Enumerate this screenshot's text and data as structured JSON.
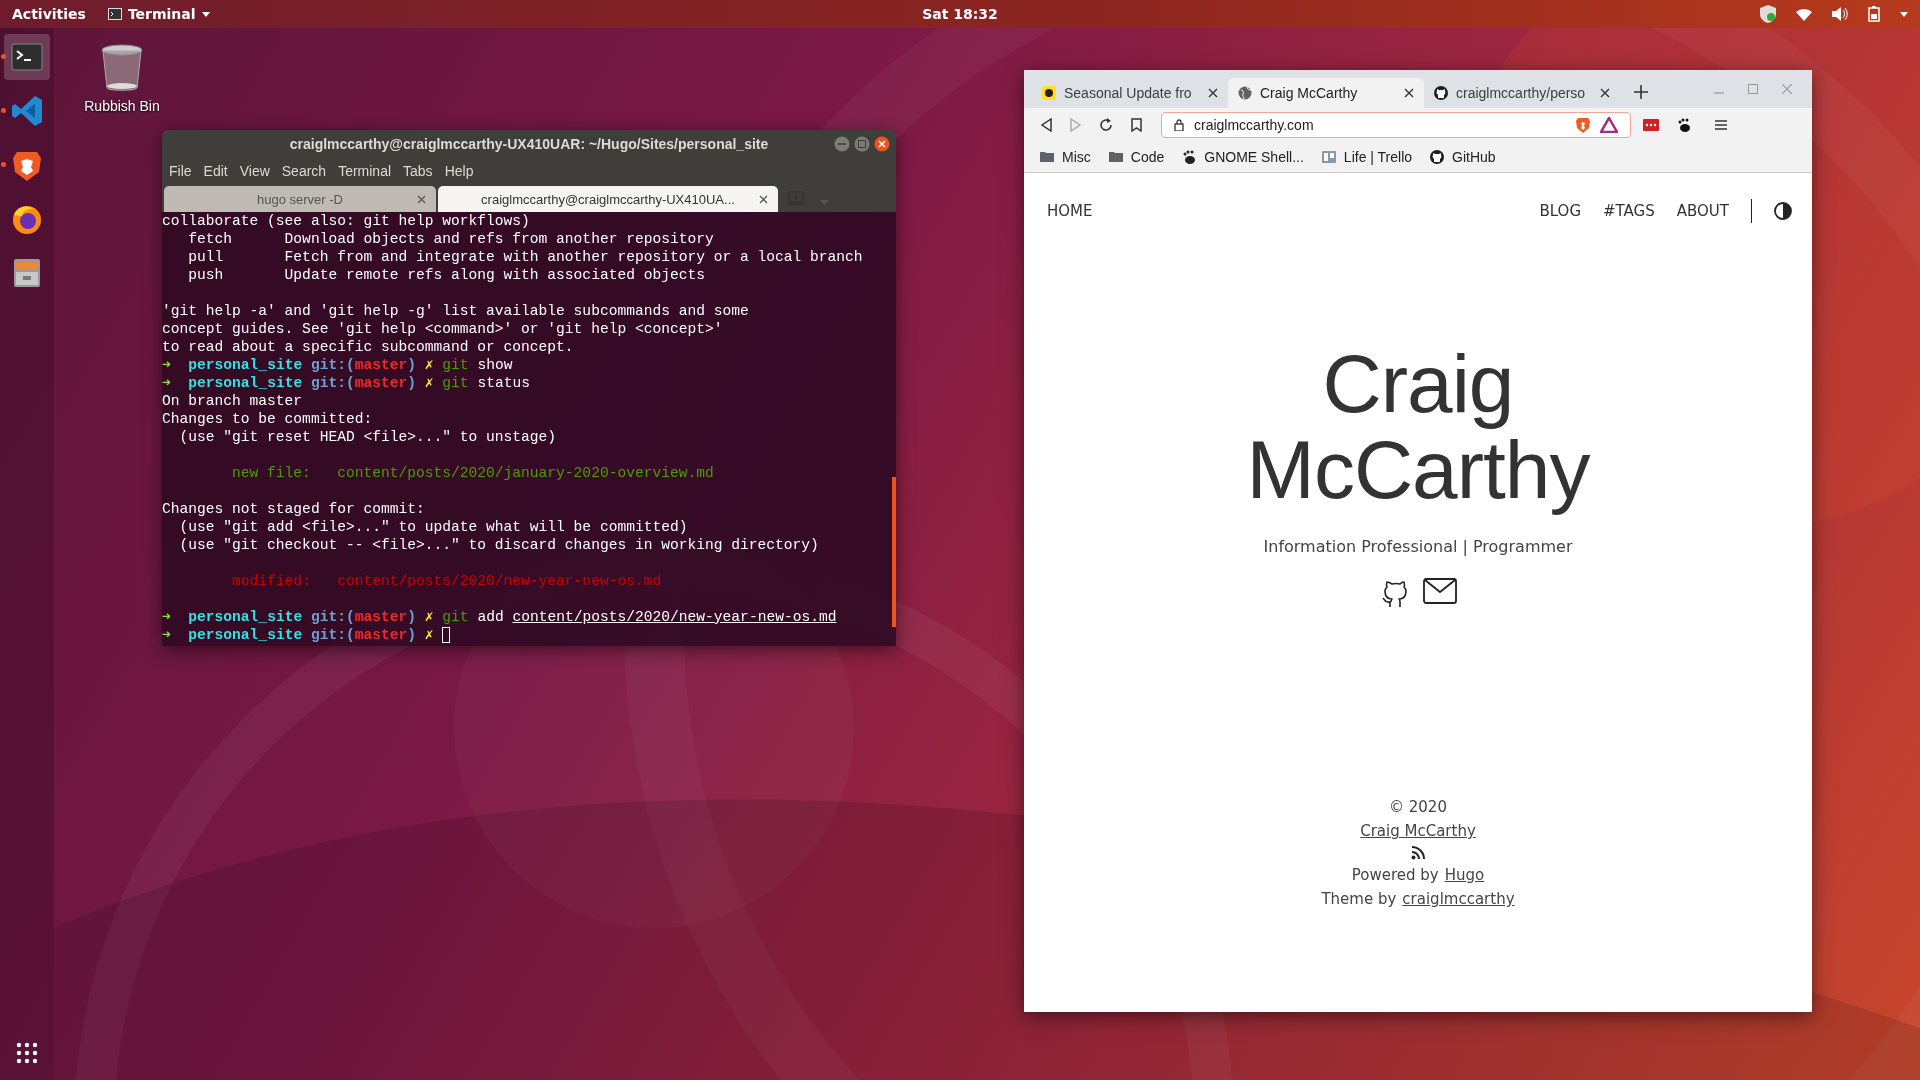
{
  "top_bar": {
    "activities": "Activities",
    "app_menu": "Terminal",
    "clock": "Sat 18:32"
  },
  "dock": {
    "items": [
      {
        "kind": "terminal",
        "running": true,
        "selected": true
      },
      {
        "kind": "code-editor",
        "running": true,
        "selected": false
      },
      {
        "kind": "lion-browser",
        "running": true,
        "selected": false
      },
      {
        "kind": "fox-browser",
        "running": false,
        "selected": false
      },
      {
        "kind": "files",
        "running": false,
        "selected": false
      }
    ]
  },
  "desktop_icons": [
    {
      "label": "Rubbish Bin"
    }
  ],
  "terminal": {
    "title": "craiglmccarthy@craiglmccarthy-UX410UAR: ~/Hugo/Sites/personal_site",
    "menu": [
      "File",
      "Edit",
      "View",
      "Search",
      "Terminal",
      "Tabs",
      "Help"
    ],
    "tabs": [
      {
        "label": "hugo server -D",
        "selected": false
      },
      {
        "label": "craiglmccarthy@craiglmccarthy-UX410UA...",
        "selected": true
      }
    ],
    "lines": [
      {
        "kind": "text",
        "segments": [
          {
            "kind": "plain",
            "text": "collaborate (see also: git help workflows)"
          }
        ]
      },
      {
        "kind": "text",
        "segments": [
          {
            "kind": "plain",
            "text": "   fetch      Download objects and refs from another repository"
          }
        ]
      },
      {
        "kind": "text",
        "segments": [
          {
            "kind": "plain",
            "text": "   pull       Fetch from and integrate with another repository or a local branch"
          }
        ]
      },
      {
        "kind": "text",
        "segments": [
          {
            "kind": "plain",
            "text": "   push       Update remote refs along with associated objects"
          }
        ]
      },
      {
        "kind": "blank"
      },
      {
        "kind": "text",
        "segments": [
          {
            "kind": "plain",
            "text": "'git help -a' and 'git help -g' list available subcommands and some"
          }
        ]
      },
      {
        "kind": "text",
        "segments": [
          {
            "kind": "plain",
            "text": "concept guides. See 'git help <command>' or 'git help <concept>'"
          }
        ]
      },
      {
        "kind": "text",
        "segments": [
          {
            "kind": "plain",
            "text": "to read about a specific subcommand or concept."
          }
        ]
      },
      {
        "kind": "text",
        "segments": [
          {
            "kind": "arrow",
            "text": "➜  "
          },
          {
            "kind": "dir",
            "text": "personal_site"
          },
          {
            "kind": "git",
            "text": " git:("
          },
          {
            "kind": "branch",
            "text": "master"
          },
          {
            "kind": "git",
            "text": ")"
          },
          {
            "kind": "dirty",
            "text": " ✗ "
          },
          {
            "kind": "cmd",
            "text": "git"
          },
          {
            "kind": "plain",
            "text": " show"
          }
        ]
      },
      {
        "kind": "text",
        "segments": [
          {
            "kind": "arrow",
            "text": "➜  "
          },
          {
            "kind": "dir",
            "text": "personal_site"
          },
          {
            "kind": "git",
            "text": " git:("
          },
          {
            "kind": "branch",
            "text": "master"
          },
          {
            "kind": "git",
            "text": ")"
          },
          {
            "kind": "dirty",
            "text": " ✗ "
          },
          {
            "kind": "cmd",
            "text": "git"
          },
          {
            "kind": "plain",
            "text": " status"
          }
        ]
      },
      {
        "kind": "text",
        "segments": [
          {
            "kind": "plain",
            "text": "On branch master"
          }
        ]
      },
      {
        "kind": "text",
        "segments": [
          {
            "kind": "plain",
            "text": "Changes to be committed:"
          }
        ]
      },
      {
        "kind": "text",
        "segments": [
          {
            "kind": "plain",
            "text": "  (use \"git reset HEAD <file>...\" to unstage)"
          }
        ]
      },
      {
        "kind": "blank"
      },
      {
        "kind": "text",
        "segments": [
          {
            "kind": "staged",
            "text": "        new file:   content/posts/2020/january-2020-overview.md"
          }
        ]
      },
      {
        "kind": "blank"
      },
      {
        "kind": "text",
        "segments": [
          {
            "kind": "plain",
            "text": "Changes not staged for commit:"
          }
        ]
      },
      {
        "kind": "text",
        "segments": [
          {
            "kind": "plain",
            "text": "  (use \"git add <file>...\" to update what will be committed)"
          }
        ]
      },
      {
        "kind": "text",
        "segments": [
          {
            "kind": "plain",
            "text": "  (use \"git checkout -- <file>...\" to discard changes in working directory)"
          }
        ]
      },
      {
        "kind": "blank"
      },
      {
        "kind": "text",
        "segments": [
          {
            "kind": "unstaged",
            "text": "        modified:   content/posts/2020/new-year-new-os.md"
          }
        ]
      },
      {
        "kind": "blank"
      },
      {
        "kind": "text",
        "segments": [
          {
            "kind": "arrow",
            "text": "➜  "
          },
          {
            "kind": "dir",
            "text": "personal_site"
          },
          {
            "kind": "git",
            "text": " git:("
          },
          {
            "kind": "branch",
            "text": "master"
          },
          {
            "kind": "git",
            "text": ")"
          },
          {
            "kind": "dirty",
            "text": " ✗ "
          },
          {
            "kind": "cmd",
            "text": "git"
          },
          {
            "kind": "plain",
            "text": " add "
          },
          {
            "kind": "path",
            "text": "content/posts/2020/new-year-new-os.md"
          }
        ]
      },
      {
        "kind": "text",
        "cursor": true,
        "segments": [
          {
            "kind": "arrow",
            "text": "➜  "
          },
          {
            "kind": "dir",
            "text": "personal_site"
          },
          {
            "kind": "git",
            "text": " git:("
          },
          {
            "kind": "branch",
            "text": "master"
          },
          {
            "kind": "git",
            "text": ")"
          },
          {
            "kind": "dirty",
            "text": " ✗ "
          }
        ]
      }
    ]
  },
  "browser": {
    "tabs": [
      {
        "kind": "mail",
        "label": "Seasonal Update fro",
        "selected": false
      },
      {
        "kind": "globe",
        "label": "Craig McCarthy",
        "selected": true
      },
      {
        "kind": "octocat",
        "label": "craiglmccarthy/perso",
        "selected": false
      }
    ],
    "address": "craiglmccarthy.com",
    "bookmarks": [
      {
        "kind": "folder",
        "label": "Misc"
      },
      {
        "kind": "folder",
        "label": "Code"
      },
      {
        "kind": "foot",
        "label": "GNOME Shell..."
      },
      {
        "kind": "board",
        "label": "Life | Trello"
      },
      {
        "kind": "octocat",
        "label": "GitHub"
      }
    ],
    "page": {
      "home": "HOME",
      "nav": [
        "BLOG",
        "#TAGS",
        "ABOUT"
      ],
      "name": "Craig McCarthy",
      "tagline": "Information Professional | Programmer",
      "footer": {
        "copyright": "© 2020",
        "author": "Craig McCarthy",
        "powered_prefix": "Powered by",
        "powered_link": "Hugo",
        "theme_prefix": "Theme by",
        "theme_link": "craiglmccarthy"
      }
    }
  }
}
